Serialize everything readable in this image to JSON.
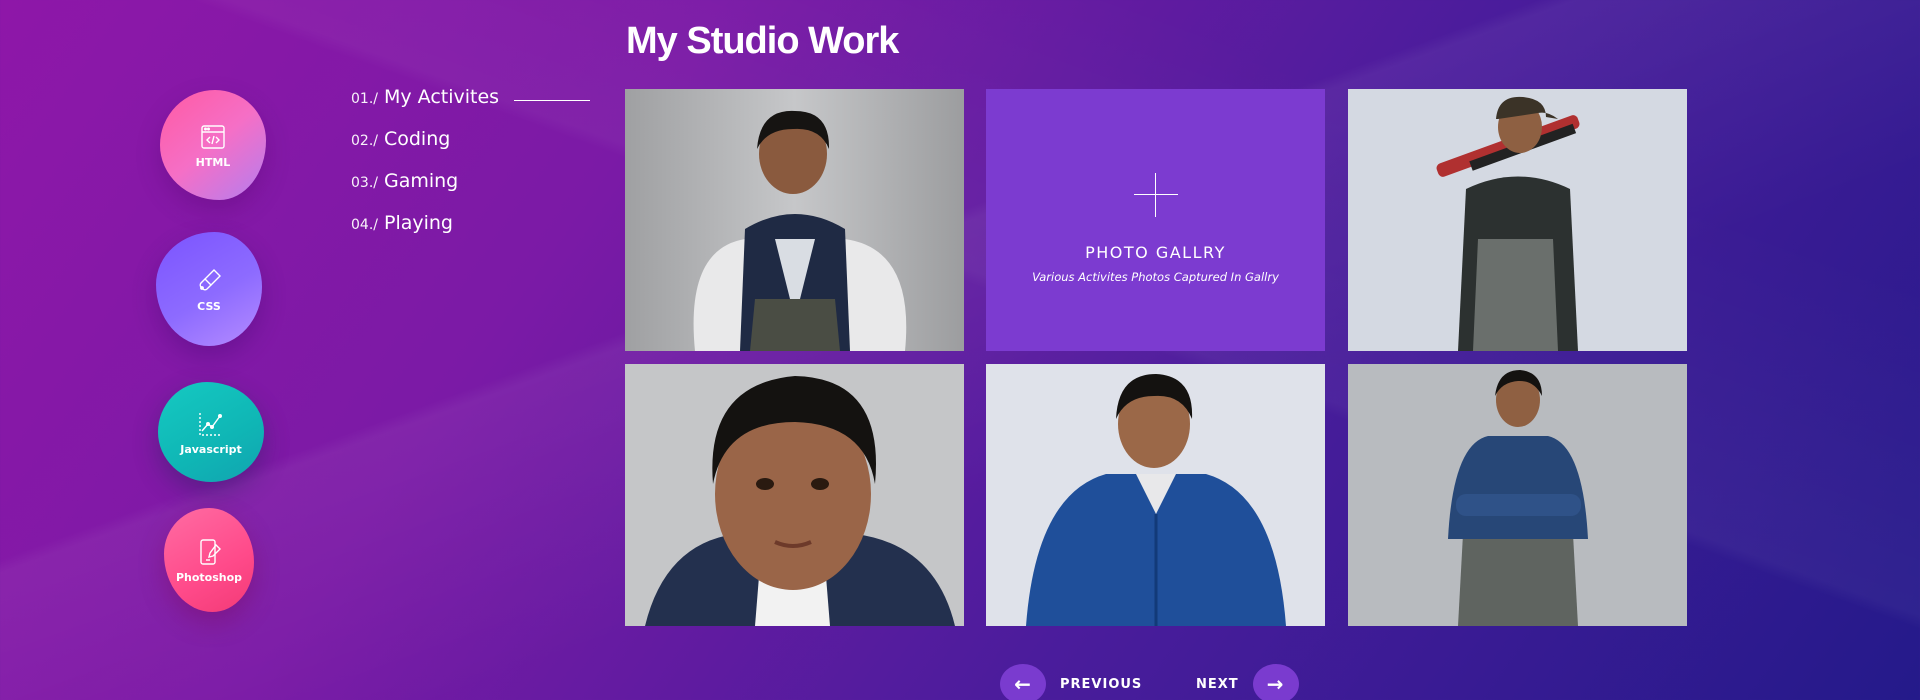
{
  "skills": [
    {
      "label": "HTML",
      "icon": "code-window-icon"
    },
    {
      "label": "CSS",
      "icon": "paint-brush-icon"
    },
    {
      "label": "Javascript",
      "icon": "line-chart-icon"
    },
    {
      "label": "Photoshop",
      "icon": "mobile-pen-icon"
    }
  ],
  "menu": {
    "items": [
      {
        "num": "01./",
        "label": "My Activites"
      },
      {
        "num": "02./",
        "label": "Coding"
      },
      {
        "num": "03./",
        "label": "Gaming"
      },
      {
        "num": "04./",
        "label": "Playing"
      }
    ]
  },
  "page": {
    "title": "My Studio Work"
  },
  "gallery": {
    "feature": {
      "title": "PHOTO GALLRY",
      "subtitle": "Various Activites Photos Captured In Gallry",
      "icon": "plus-icon"
    }
  },
  "pager": {
    "previous": "PREVIOUS",
    "next": "NEXT",
    "prev_icon": "arrow-left-icon",
    "next_icon": "arrow-right-icon"
  },
  "colors": {
    "accent": "#7c3bd0",
    "bg_start": "#8e17a8",
    "bg_end": "#241a8a"
  }
}
